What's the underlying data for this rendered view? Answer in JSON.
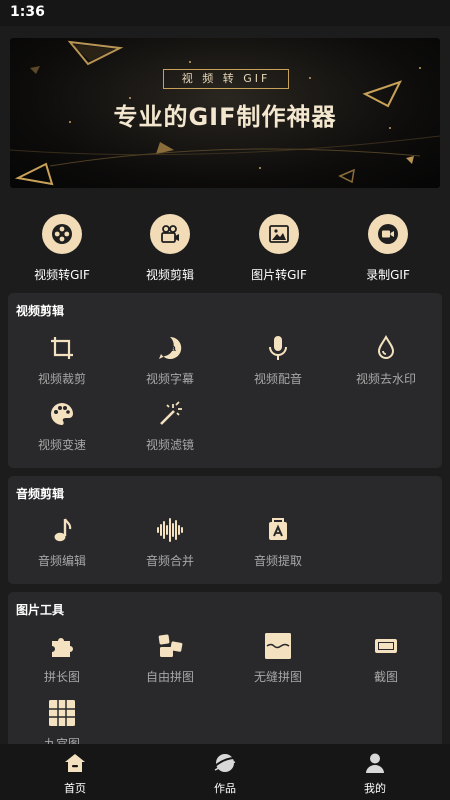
{
  "status_bar": {
    "time": "1:36"
  },
  "banner": {
    "tag": "视 频 转 GIF",
    "title": "专业的GIF制作神器"
  },
  "main_tools": [
    {
      "label": "视频转GIF",
      "icon": "film-reel-icon"
    },
    {
      "label": "视频剪辑",
      "icon": "video-camera-icon"
    },
    {
      "label": "图片转GIF",
      "icon": "image-icon"
    },
    {
      "label": "录制GIF",
      "icon": "record-icon"
    }
  ],
  "sections": {
    "video_edit": {
      "title": "视频剪辑",
      "items": [
        {
          "label": "视频裁剪",
          "icon": "crop-icon"
        },
        {
          "label": "视频字幕",
          "icon": "subtitle-icon"
        },
        {
          "label": "视频配音",
          "icon": "microphone-icon"
        },
        {
          "label": "视频去水印",
          "icon": "water-drop-icon"
        },
        {
          "label": "视频变速",
          "icon": "palette-icon"
        },
        {
          "label": "视频滤镜",
          "icon": "magic-wand-icon"
        }
      ]
    },
    "audio_edit": {
      "title": "音频剪辑",
      "items": [
        {
          "label": "音频编辑",
          "icon": "music-note-icon"
        },
        {
          "label": "音频合并",
          "icon": "waveform-icon"
        },
        {
          "label": "音频提取",
          "icon": "audio-extract-icon"
        }
      ]
    },
    "image_tools": {
      "title": "图片工具",
      "items": [
        {
          "label": "拼长图",
          "icon": "puzzle-icon"
        },
        {
          "label": "自由拼图",
          "icon": "free-collage-icon"
        },
        {
          "label": "无缝拼图",
          "icon": "seamless-collage-icon"
        },
        {
          "label": "截图",
          "icon": "screenshot-icon"
        },
        {
          "label": "九宫图",
          "icon": "nine-grid-icon"
        }
      ]
    }
  },
  "bottom_nav": [
    {
      "label": "首页",
      "icon": "home-icon",
      "active": true
    },
    {
      "label": "作品",
      "icon": "works-icon",
      "active": false
    },
    {
      "label": "我的",
      "icon": "profile-icon",
      "active": false
    }
  ],
  "colors": {
    "background": "#1c1c1d",
    "card": "#29292b",
    "accent": "#f1dcb7",
    "icon_gold": "#f3e1bf",
    "label_gray": "#a7a7a7"
  }
}
